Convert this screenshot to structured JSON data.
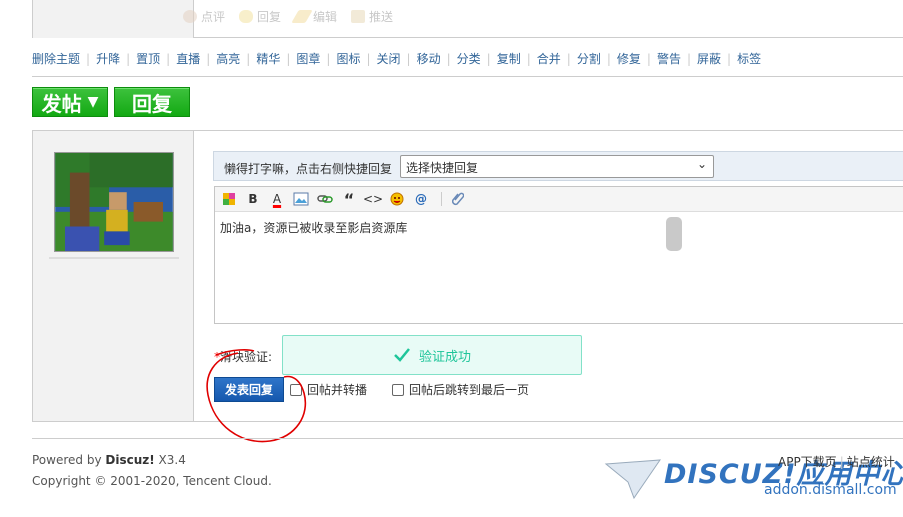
{
  "post_actions": [
    {
      "label": "点评",
      "icon": "review-icon"
    },
    {
      "label": "回复",
      "icon": "reply-icon"
    },
    {
      "label": "编辑",
      "icon": "edit-icon"
    },
    {
      "label": "推送",
      "icon": "push-icon"
    }
  ],
  "mod_bar": [
    "删除主题",
    "升降",
    "置顶",
    "直播",
    "高亮",
    "精华",
    "图章",
    "图标",
    "关闭",
    "移动",
    "分类",
    "复制",
    "合并",
    "分割",
    "修复",
    "警告",
    "屏蔽",
    "标签"
  ],
  "buttons": {
    "post": "发帖",
    "reply": "回复"
  },
  "fast_reply": {
    "hint": "懒得打字嘛，点击右侧快捷回复",
    "select_value": "选择快捷回复"
  },
  "editor": {
    "content": "加油a，资源已被收录至影启资源库",
    "toolbar": [
      "font-color-icon",
      "bold-icon",
      "text-color-icon",
      "image-icon",
      "link-icon",
      "quote-icon",
      "code-icon",
      "emoji-icon",
      "mention-icon",
      "attachment-icon"
    ]
  },
  "captcha": {
    "star": "*",
    "label": "滑块验证:",
    "status": "验证成功"
  },
  "submit": {
    "label": "发表回复"
  },
  "options": {
    "cb1": "回帖并转播",
    "cb2": "回帖后跳转到最后一页"
  },
  "footer": {
    "powered_prefix": "Powered by ",
    "powered_brand": "Discuz!",
    "version": " X3.4",
    "copyright": "Copyright © 2001-2020, Tencent Cloud.",
    "app_download": "APP下载页",
    "site_stats": "站点统计"
  },
  "watermark": {
    "logo": "DISCUZ!应用中心",
    "url": "addon.dismall.com"
  },
  "colors": {
    "accent_green": "#13a913",
    "link_blue": "#336699",
    "submit_blue": "#1558ae",
    "success": "#1ec59a",
    "annotation_red": "#e00000"
  }
}
